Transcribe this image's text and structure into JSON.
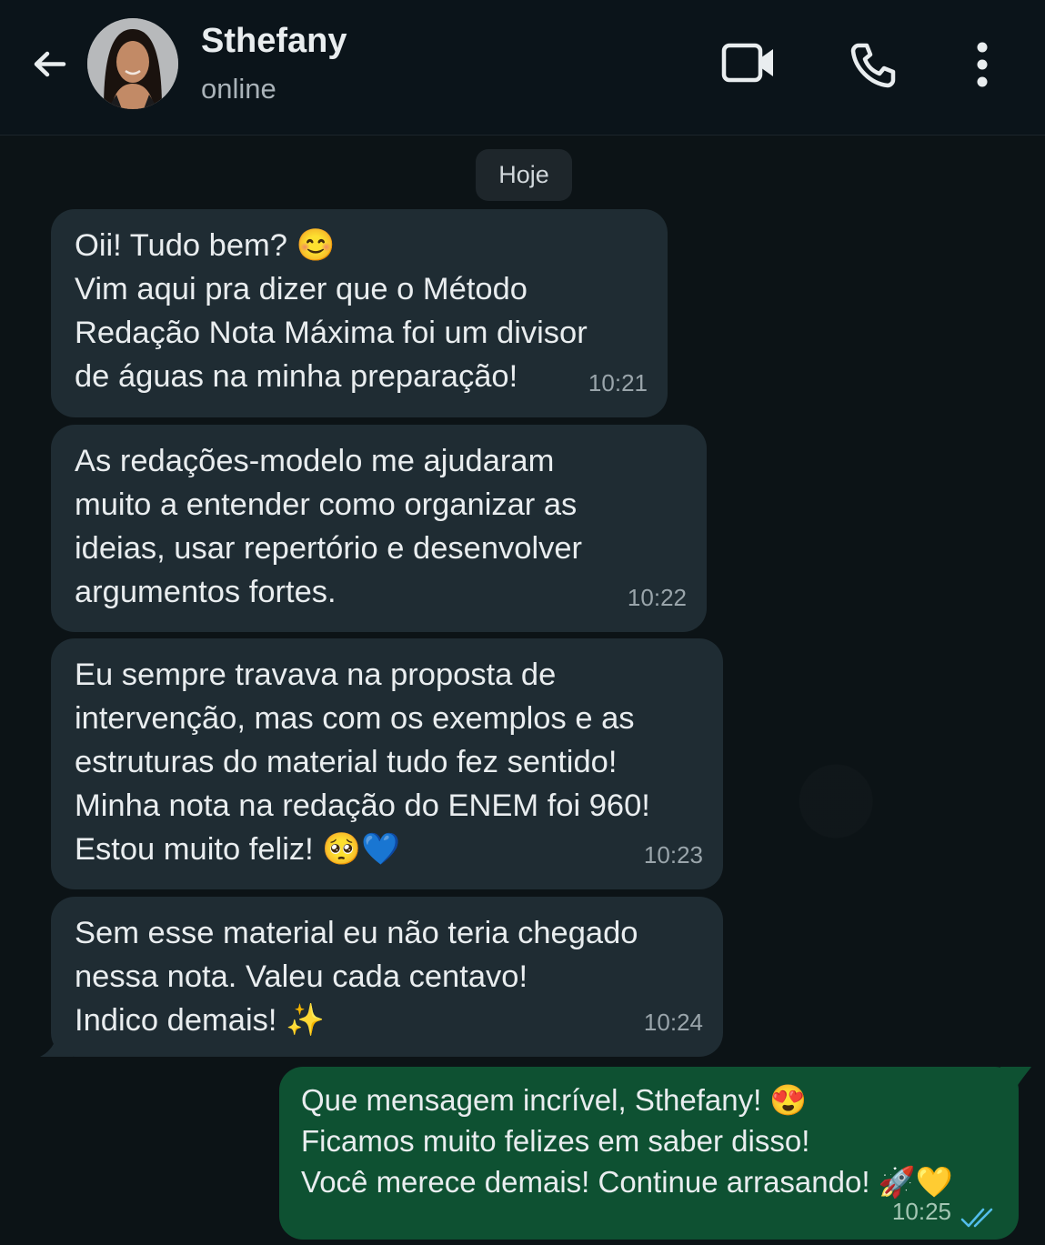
{
  "header": {
    "contact_name": "Sthefany",
    "status": "online"
  },
  "chat": {
    "date_chip": "Hoje",
    "messages": [
      {
        "direction": "in",
        "lines": [
          "Oii! Tudo bem? 😊",
          "Vim aqui pra dizer que o Método",
          "Redação Nota Máxima foi um divisor",
          "de águas na minha preparação!"
        ],
        "time": "10:21"
      },
      {
        "direction": "in",
        "lines": [
          "As redações-modelo me ajudaram",
          "muito a entender como organizar as",
          "ideias, usar repertório e desenvolver",
          "argumentos fortes."
        ],
        "time": "10:22"
      },
      {
        "direction": "in",
        "lines": [
          "Eu sempre travava na proposta de",
          "intervenção, mas com os exemplos e as",
          "estruturas do material tudo fez sentido!",
          "Minha nota na redação do ENEM foi 960!",
          "Estou muito feliz!  🥺💙"
        ],
        "time": "10:23"
      },
      {
        "direction": "in",
        "lines": [
          "Sem esse material eu não teria chegado",
          "nessa nota. Valeu cada centavo!",
          "Indico demais! ✨"
        ],
        "time": "10:24"
      },
      {
        "direction": "out",
        "lines": [
          "Que mensagem incrível, Sthefany! 😍",
          "Ficamos muito felizes em saber disso!",
          "Você merece demais! Continue arrasando! 🚀💛"
        ],
        "time": "10:25",
        "read": true
      }
    ]
  },
  "colors": {
    "header_bg": "#0b141a",
    "chat_bg": "#0c1316",
    "incoming_bubble": "#1f2c33",
    "outgoing_bubble": "#0e5132",
    "read_ticks": "#53bdeb"
  },
  "icons": {
    "back": "arrow-left-icon",
    "video": "video-camera-icon",
    "call": "phone-icon",
    "menu": "more-vertical-icon",
    "read": "double-check-icon"
  }
}
